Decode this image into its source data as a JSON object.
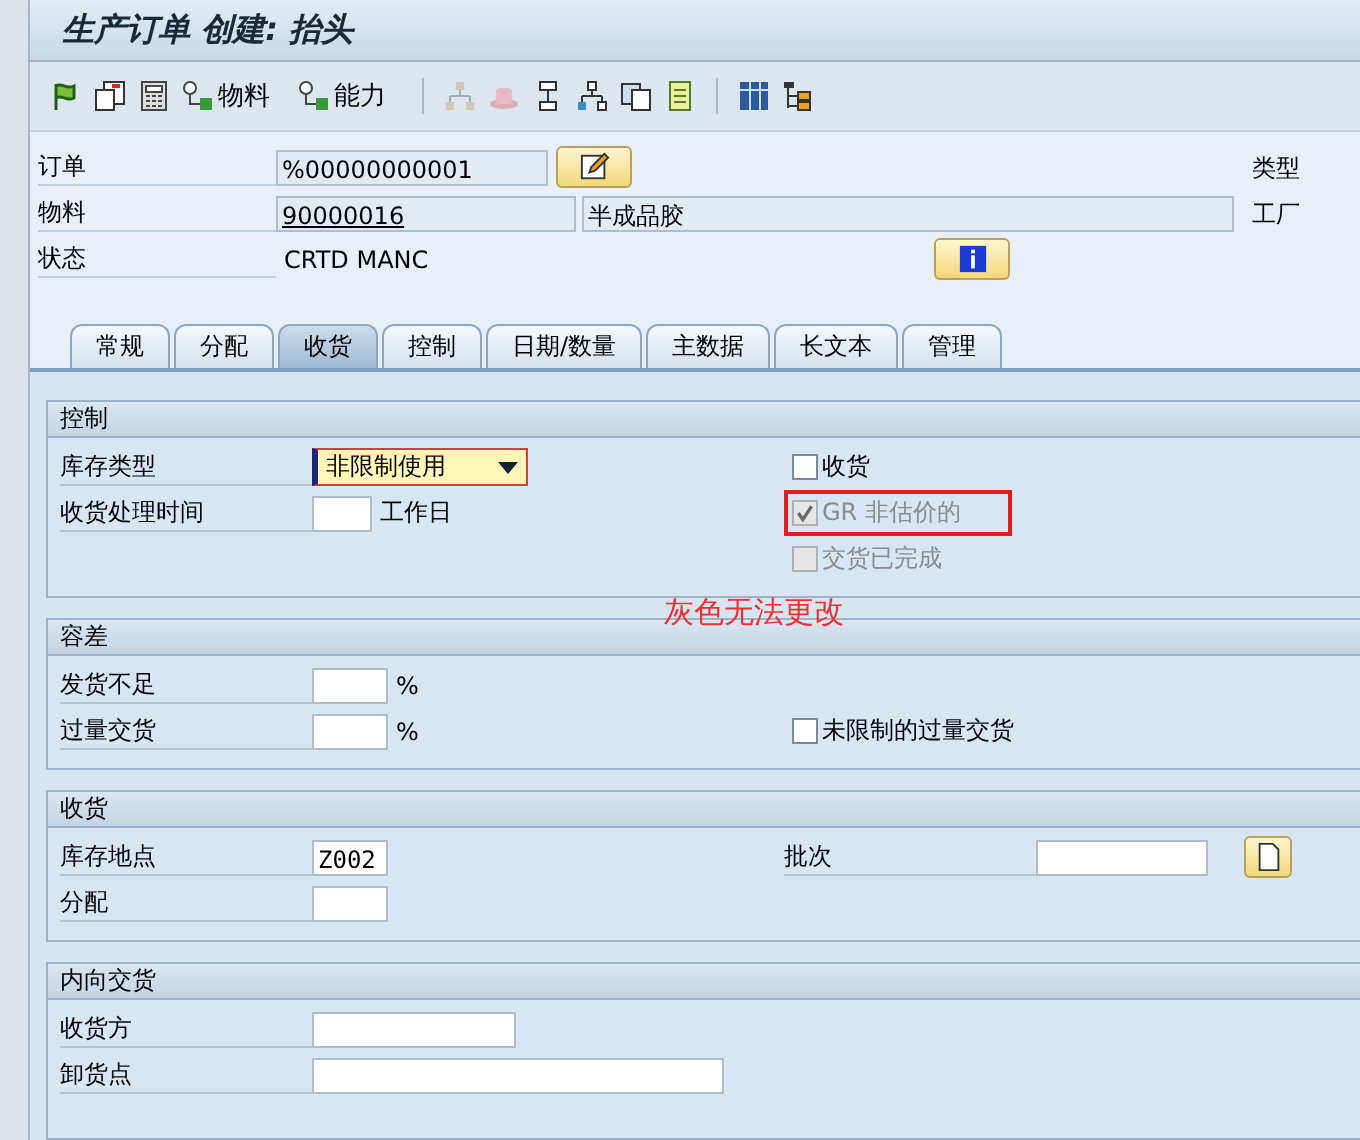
{
  "window": {
    "title": "生产订单 创建: 抬头"
  },
  "toolbar": {
    "material_button": {
      "label": "物料"
    },
    "capacity_button": {
      "label": "能力"
    }
  },
  "header": {
    "order": {
      "label": "订单",
      "value": "%00000000001"
    },
    "material": {
      "label": "物料",
      "value": "90000016",
      "description": "半成品胶"
    },
    "status": {
      "label": "状态",
      "value": "CRTD MANC"
    },
    "type_label": "类型",
    "plant_label": "工厂"
  },
  "tabs": [
    {
      "label": "常规",
      "selected": false
    },
    {
      "label": "分配",
      "selected": false
    },
    {
      "label": "收货",
      "selected": true
    },
    {
      "label": "控制",
      "selected": false
    },
    {
      "label": "日期/数量",
      "selected": false
    },
    {
      "label": "主数据",
      "selected": false
    },
    {
      "label": "长文本",
      "selected": false
    },
    {
      "label": "管理",
      "selected": false
    }
  ],
  "control": {
    "title": "控制",
    "stock_type": {
      "label": "库存类型",
      "value": "非限制使用"
    },
    "gr_processing_time": {
      "label": "收货处理时间",
      "unit": "工作日"
    },
    "checkboxes": [
      {
        "label": "收货",
        "checked": false,
        "disabled": false,
        "highlighted": false
      },
      {
        "label": "GR 非估价的",
        "checked": true,
        "disabled": true,
        "highlighted": true
      },
      {
        "label": "交货已完成",
        "checked": false,
        "disabled": true,
        "highlighted": false
      }
    ],
    "annotation": "灰色无法更改"
  },
  "tolerance": {
    "title": "容差",
    "underdelivery": {
      "label": "发货不足",
      "unit": "%"
    },
    "overdelivery": {
      "label": "过量交货",
      "unit": "%"
    },
    "unlimited": {
      "label": "未限制的过量交货",
      "checked": false
    }
  },
  "goods_receipt": {
    "title": "收货",
    "storage_location": {
      "label": "库存地点",
      "value": "Z002"
    },
    "distribution": {
      "label": "分配"
    },
    "batch": {
      "label": "批次"
    }
  },
  "inbound": {
    "title": "内向交货",
    "recipient": {
      "label": "收货方"
    },
    "unloading_point": {
      "label": "卸货点"
    }
  }
}
